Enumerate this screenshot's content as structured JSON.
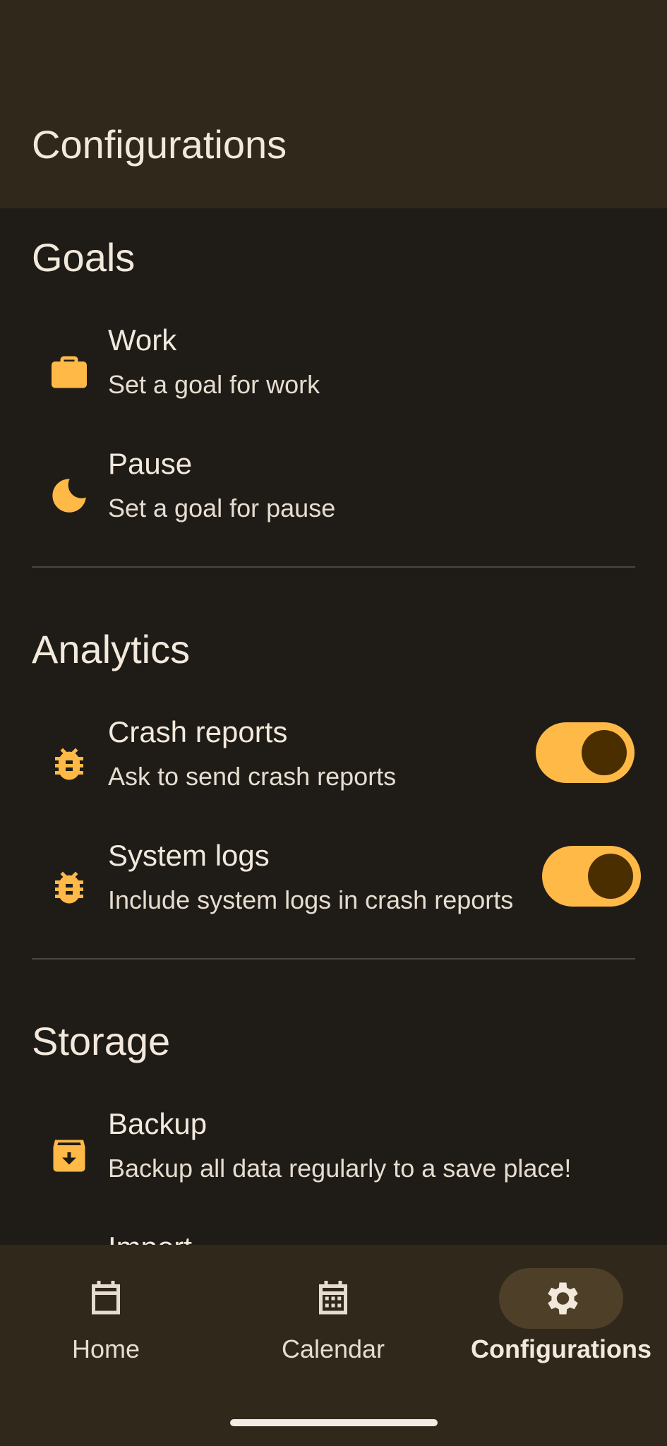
{
  "appbar": {
    "title": "Configurations"
  },
  "colors": {
    "accent": "#ffb947",
    "background": "#1f1c18",
    "surface": "#30281b"
  },
  "sections": {
    "goals": {
      "title": "Goals",
      "items": [
        {
          "icon": "briefcase-icon",
          "title": "Work",
          "subtitle": "Set a goal for work"
        },
        {
          "icon": "moon-icon",
          "title": "Pause",
          "subtitle": "Set a goal for pause"
        }
      ]
    },
    "analytics": {
      "title": "Analytics",
      "items": [
        {
          "icon": "bug-icon",
          "title": "Crash reports",
          "subtitle": "Ask to send crash reports",
          "enabled": true
        },
        {
          "icon": "bug-icon",
          "title": "System logs",
          "subtitle": "Include system logs in crash reports",
          "enabled": true
        }
      ]
    },
    "storage": {
      "title": "Storage",
      "items": [
        {
          "icon": "archive-download-icon",
          "title": "Backup",
          "subtitle": "Backup all data regularly to a save place!"
        },
        {
          "icon": "import-icon",
          "title": "Import",
          "subtitle": ""
        }
      ]
    }
  },
  "nav": {
    "items": [
      {
        "icon": "calendar-blank-icon",
        "label": "Home",
        "active": false
      },
      {
        "icon": "calendar-grid-icon",
        "label": "Calendar",
        "active": false
      },
      {
        "icon": "gear-icon",
        "label": "Configurations",
        "active": true
      }
    ]
  }
}
